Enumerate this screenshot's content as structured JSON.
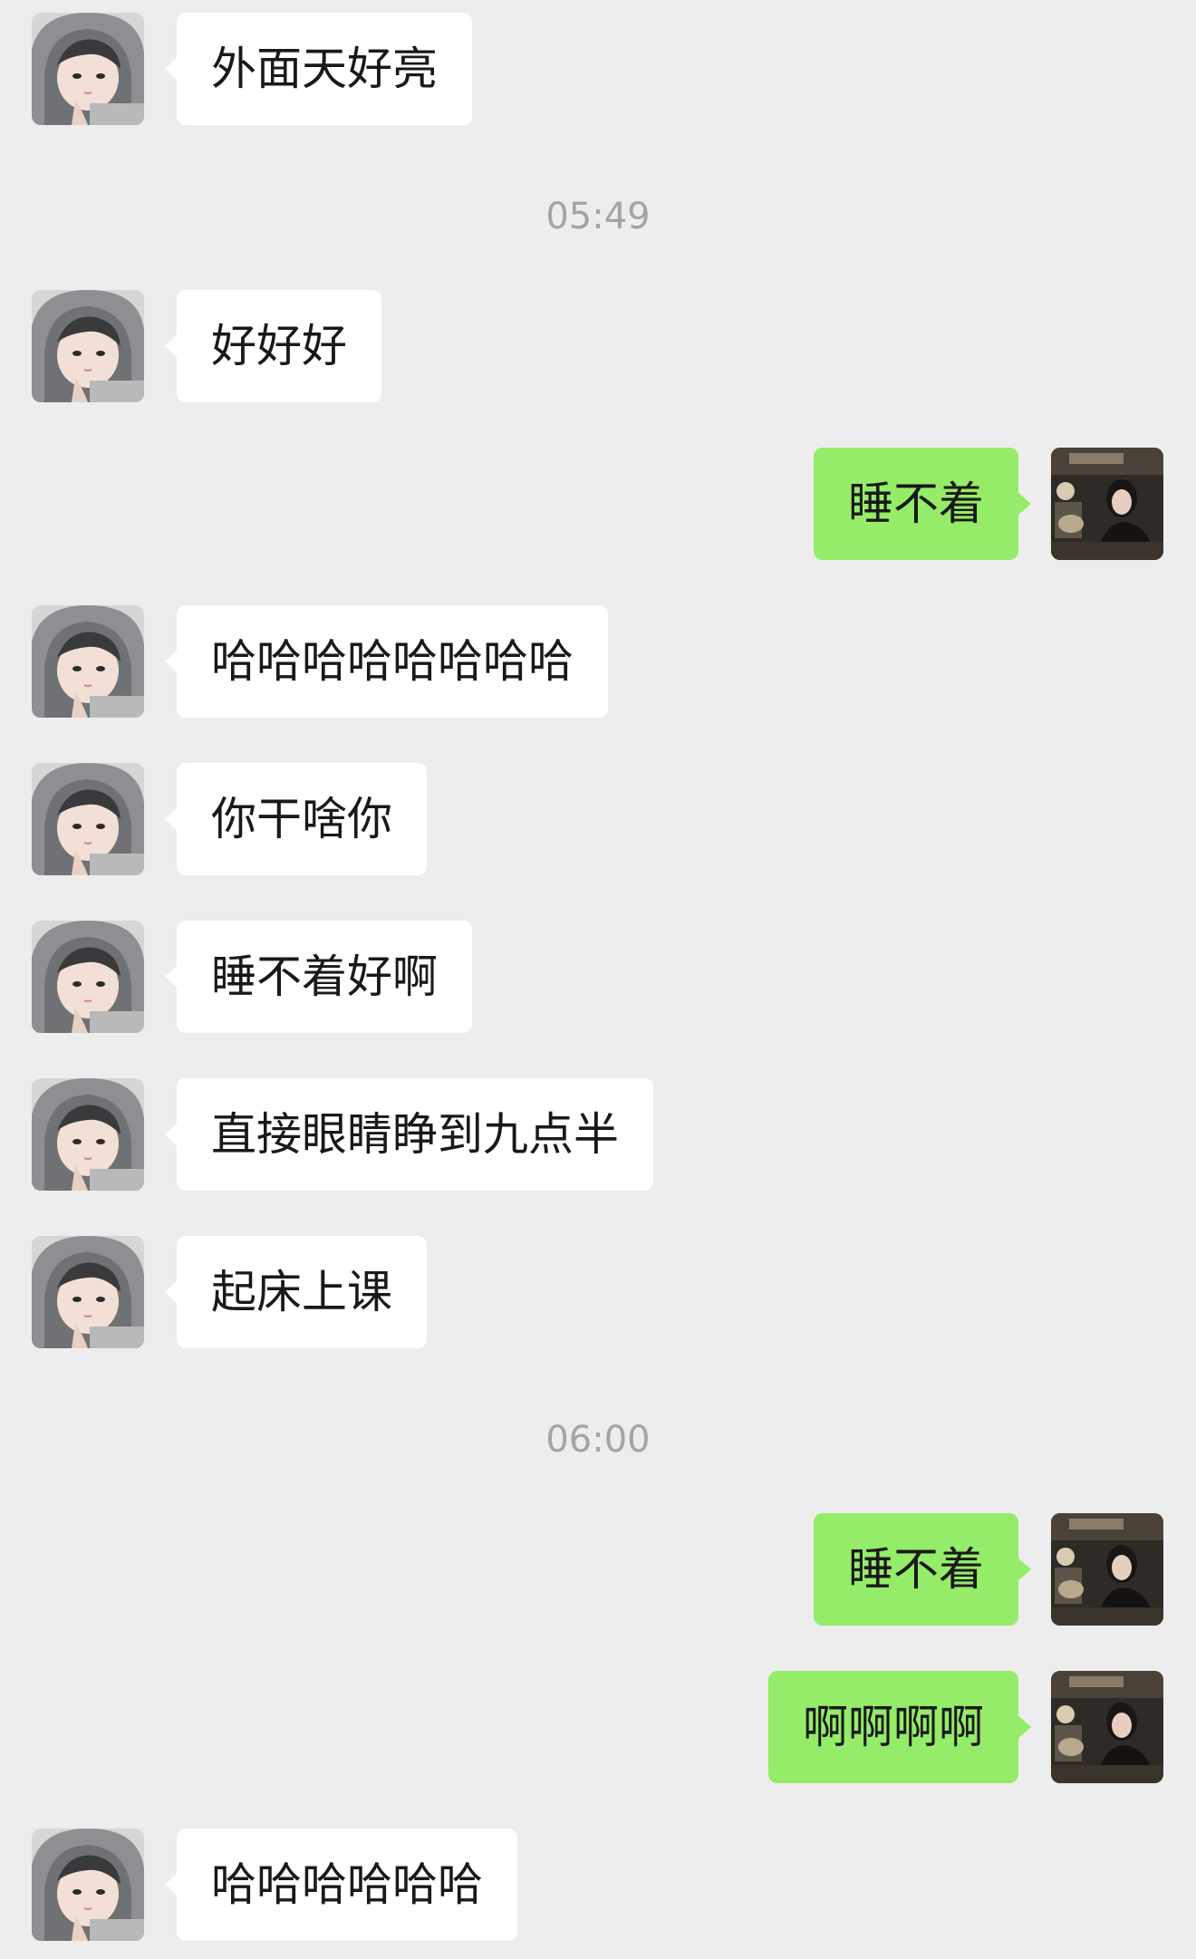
{
  "chat": {
    "messages": [
      {
        "side": "in",
        "text": "外面天好亮"
      },
      {
        "type": "time",
        "text": "05:49"
      },
      {
        "side": "in",
        "text": "好好好"
      },
      {
        "side": "out",
        "text": "睡不着"
      },
      {
        "side": "in",
        "text": "哈哈哈哈哈哈哈哈"
      },
      {
        "side": "in",
        "text": "你干啥你"
      },
      {
        "side": "in",
        "text": "睡不着好啊"
      },
      {
        "side": "in",
        "text": "直接眼睛睁到九点半"
      },
      {
        "side": "in",
        "text": "起床上课"
      },
      {
        "type": "time",
        "text": "06:00"
      },
      {
        "side": "out",
        "text": "睡不着"
      },
      {
        "side": "out",
        "text": "啊啊啊啊"
      },
      {
        "side": "in",
        "text": "哈哈哈哈哈哈"
      }
    ]
  },
  "colors": {
    "background": "#ededed",
    "incoming_bubble": "#ffffff",
    "outgoing_bubble": "#95ec69",
    "text": "#191919",
    "timestamp": "#a4a4a4"
  },
  "icons": {
    "incoming_avatar": "contact-avatar-hooded-person",
    "outgoing_avatar": "user-avatar-woman-in-dark-room"
  }
}
